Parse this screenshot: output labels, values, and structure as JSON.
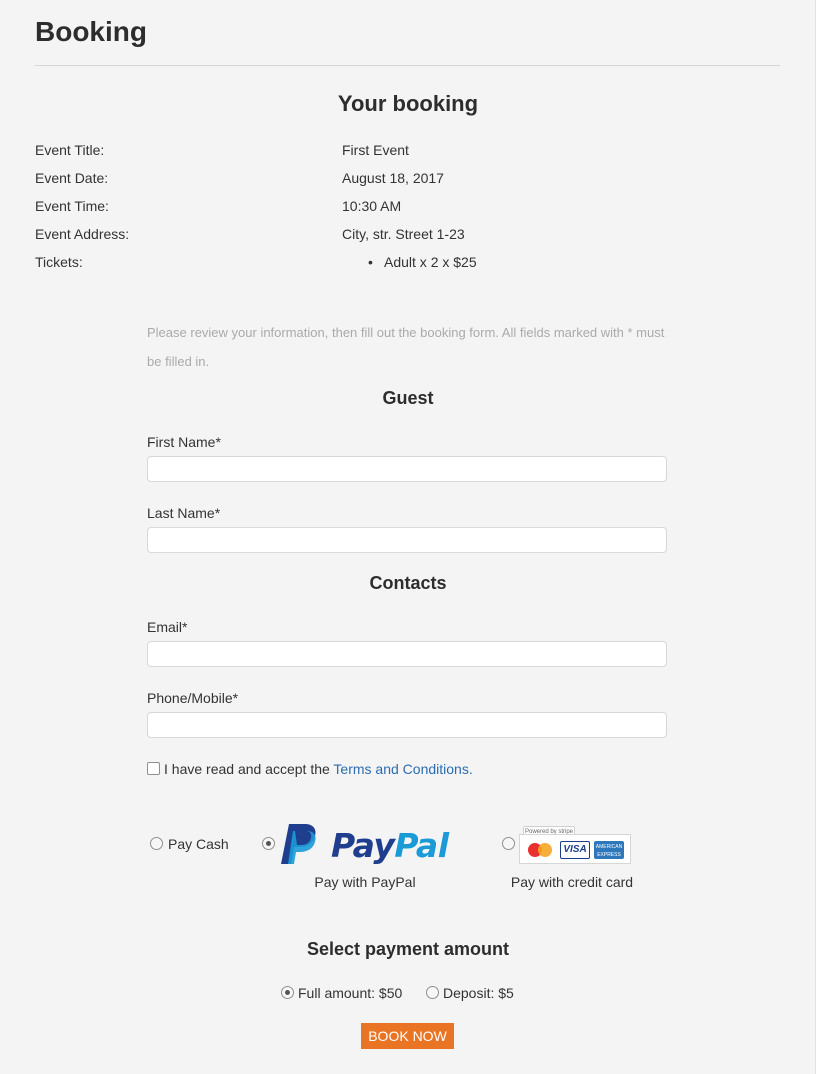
{
  "page": {
    "title": "Booking"
  },
  "booking": {
    "heading": "Your booking",
    "details": [
      {
        "label": "Event Title:",
        "value": "First Event"
      },
      {
        "label": "Event Date:",
        "value": "August 18, 2017"
      },
      {
        "label": "Event Time:",
        "value": "10:30 AM"
      },
      {
        "label": "Event Address:",
        "value": "City, str. Street 1-23"
      }
    ],
    "tickets_label": "Tickets:",
    "tickets": [
      "Adult x 2 x $25"
    ]
  },
  "form": {
    "intro": "Please review your information, then fill out the booking form. All fields marked with * must be filled in.",
    "guest_heading": "Guest",
    "first_name": {
      "label": "First Name*",
      "value": ""
    },
    "last_name": {
      "label": "Last Name*",
      "value": ""
    },
    "contacts_heading": "Contacts",
    "email": {
      "label": "Email*",
      "value": ""
    },
    "phone": {
      "label": "Phone/Mobile*",
      "value": ""
    },
    "terms": {
      "checked": false,
      "text": "I have read and accept the ",
      "link": "Terms and Conditions."
    }
  },
  "payment_methods": {
    "selected": "paypal",
    "cash_label": "Pay Cash",
    "paypal_logo_text": [
      "Pay",
      "Pal"
    ],
    "paypal_caption": "Pay with PayPal",
    "card_caption": "Pay with credit card",
    "card_badge_text": "Powered by stripe",
    "card_brands": [
      "mastercard-icon",
      "visa-icon",
      "amex-icon"
    ],
    "visa_text": "VISA",
    "amex_text": "AMERICAN EXPRESS"
  },
  "payment_amount": {
    "heading": "Select payment amount",
    "selected": "full",
    "full_label": "Full amount: $50",
    "deposit_label": "Deposit: $5"
  },
  "submit": {
    "label": "BOOK NOW"
  },
  "colors": {
    "accent": "#e87424",
    "link": "#2b6cb0",
    "paypal_dark": "#1f3f8e",
    "paypal_light": "#1a9ad7",
    "background": "#f4f4f4"
  }
}
